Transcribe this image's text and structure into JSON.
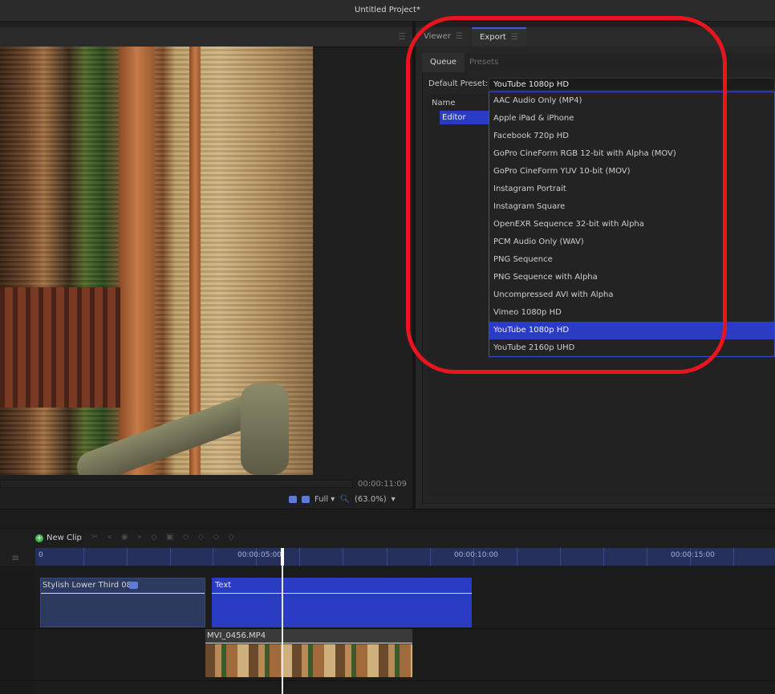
{
  "window": {
    "title": "Untitled Project*"
  },
  "viewer": {
    "timecode": "00:00:11:09",
    "quality": "Full",
    "quality_arrow": "▾",
    "zoom": "(63.0%)",
    "zoom_arrow": "▾"
  },
  "panel_tabs": [
    {
      "label": "Viewer"
    },
    {
      "label": "Export"
    }
  ],
  "export": {
    "subtabs": [
      {
        "label": "Queue"
      },
      {
        "label": "Presets"
      }
    ],
    "default_preset_label": "Default Preset:",
    "default_preset_value": "YouTube 1080p HD",
    "queue_column_name": "Name",
    "queue_row": "Editor",
    "dropdown_options": [
      "AAC Audio Only (MP4)",
      "Apple iPad & iPhone",
      "Facebook 720p HD",
      "GoPro CineForm RGB 12-bit with Alpha (MOV)",
      "GoPro CineForm YUV 10-bit (MOV)",
      "Instagram Portrait",
      "Instagram Square",
      "OpenEXR Sequence 32-bit with Alpha",
      "PCM Audio Only (WAV)",
      "PNG Sequence",
      "PNG Sequence with Alpha",
      "Uncompressed AVI with Alpha",
      "Vimeo 1080p HD",
      "YouTube 1080p HD",
      "YouTube 2160p UHD"
    ],
    "selected_index": 13
  },
  "timeline": {
    "new_clip_label": "New Clip",
    "ruler_labels": [
      "0",
      "00:00:05:00",
      "00:00:10:00",
      "00:00:15:00"
    ],
    "clips": {
      "lower_third": "Stylish Lower Third 08",
      "text": "Text",
      "video": "MVI_0456.MP4"
    }
  },
  "colors": {
    "accent": "#2b3cc4",
    "highlight_ring": "#e8141e",
    "add_icon": "#3cb84e"
  }
}
